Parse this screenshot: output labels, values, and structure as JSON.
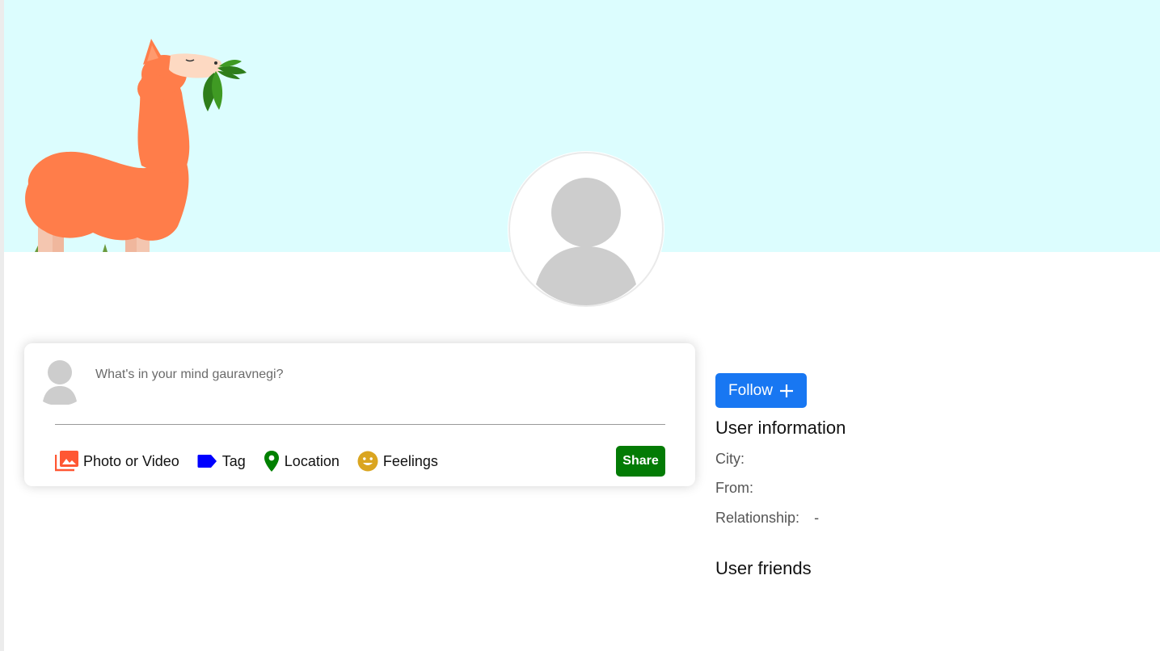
{
  "cover": {
    "background": "#dcfdfe",
    "illustration": "llama-eating-leaves"
  },
  "profile": {
    "avatar_icon": "user-silhouette-icon"
  },
  "share": {
    "placeholder": "What's in your mind gauravnegi?",
    "options": [
      {
        "label": "Photo or Video",
        "icon": "photo-library-icon",
        "color": "#ff5733"
      },
      {
        "label": "Tag",
        "icon": "label-tag-icon",
        "color": "#0000ff"
      },
      {
        "label": "Location",
        "icon": "location-pin-icon",
        "color": "#008000"
      },
      {
        "label": "Feelings",
        "icon": "smiley-face-icon",
        "color": "#daa520"
      }
    ],
    "share_label": "Share",
    "share_color": "#037b05"
  },
  "rightbar": {
    "follow_label": "Follow",
    "follow_color": "#1877f2",
    "info_title": "User information",
    "info": [
      {
        "key": "City:",
        "value": ""
      },
      {
        "key": "From:",
        "value": ""
      },
      {
        "key": "Relationship:",
        "value": "-"
      }
    ],
    "friends_title": "User friends"
  }
}
